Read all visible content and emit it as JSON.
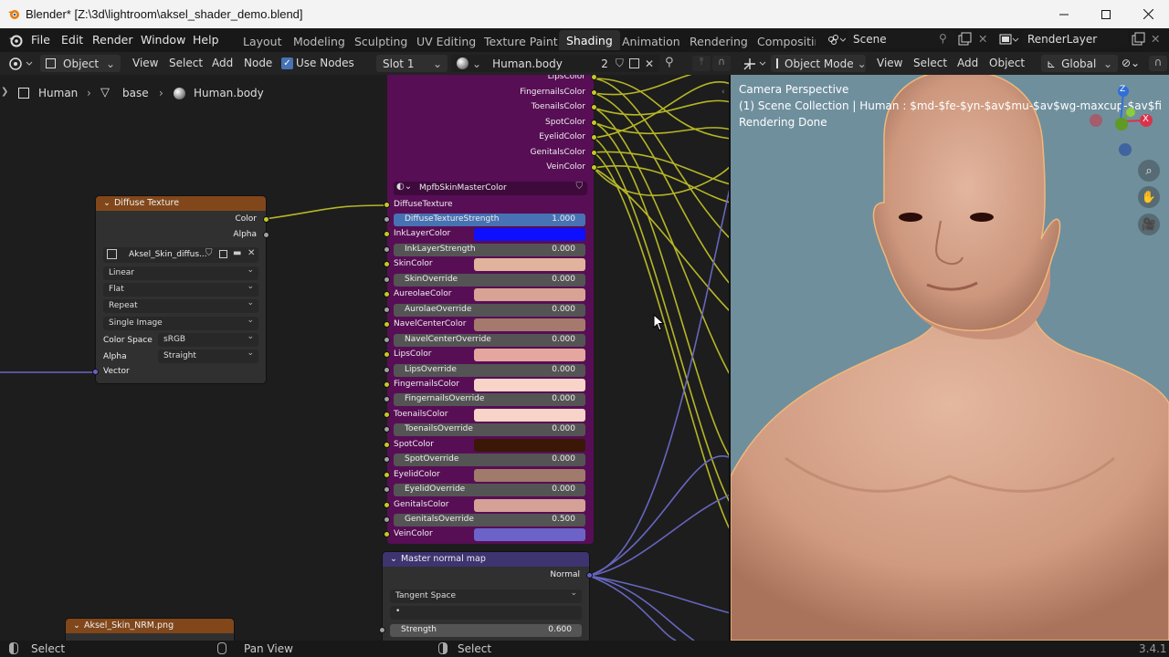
{
  "window": {
    "title": "Blender* [Z:\\3d\\lightroom\\aksel_shader_demo.blend]"
  },
  "menu": [
    "File",
    "Edit",
    "Render",
    "Window",
    "Help"
  ],
  "workspaces": [
    "Layout",
    "Modeling",
    "Sculpting",
    "UV Editing",
    "Texture Paint",
    "Shading",
    "Animation",
    "Rendering",
    "Compositing"
  ],
  "active_workspace": "Shading",
  "scene": "Scene",
  "view_layer": "RenderLayer",
  "node_header": {
    "object": "Object",
    "view": "View",
    "select": "Select",
    "add": "Add",
    "node": "Node",
    "use_nodes": "Use Nodes",
    "slot": "Slot 1",
    "material": "Human.body",
    "users": "2"
  },
  "breadcrumb": [
    "Human",
    "base",
    "Human.body"
  ],
  "viewport_header": {
    "mode": "Object Mode",
    "view": "View",
    "select": "Select",
    "add": "Add",
    "object": "Object",
    "orientation": "Global"
  },
  "diffuse_node": {
    "title": "Diffuse Texture",
    "outputs": [
      "Color",
      "Alpha"
    ],
    "image": "Aksel_Skin_diffus...",
    "interpolation": "Linear",
    "projection": "Flat",
    "extension": "Repeat",
    "source": "Single Image",
    "color_space_label": "Color Space",
    "color_space": "sRGB",
    "alpha_label": "Alpha",
    "alpha": "Straight",
    "vector": "Vector"
  },
  "group_node": {
    "top_outputs": [
      "LipsColor",
      "FingernailsColor",
      "ToenailsColor",
      "SpotColor",
      "EyelidColor",
      "GenitalsColor",
      "VeinColor"
    ],
    "group_name": "MpfbSkinMasterColor",
    "first_input": "DiffuseTexture",
    "inputs": [
      {
        "type": "val",
        "name": "DiffuseTextureStrength",
        "value": "1.000",
        "active": true
      },
      {
        "type": "color",
        "name": "InkLayerColor",
        "color": "#0f0fff"
      },
      {
        "type": "val",
        "name": "InkLayerStrength",
        "value": "0.000"
      },
      {
        "type": "color",
        "name": "SkinColor",
        "color": "#e2b39c"
      },
      {
        "type": "val",
        "name": "SkinOverride",
        "value": "0.000"
      },
      {
        "type": "color",
        "name": "AureolaeColor",
        "color": "#d8a394"
      },
      {
        "type": "val",
        "name": "AurolaeOverride",
        "value": "0.000"
      },
      {
        "type": "color",
        "name": "NavelCenterColor",
        "color": "#a57a6d"
      },
      {
        "type": "val",
        "name": "NavelCenterOverride",
        "value": "0.000"
      },
      {
        "type": "color",
        "name": "LipsColor",
        "color": "#e4a69e"
      },
      {
        "type": "val",
        "name": "LipsOverride",
        "value": "0.000"
      },
      {
        "type": "color",
        "name": "FingernailsColor",
        "color": "#f7d3c8"
      },
      {
        "type": "val",
        "name": "FingernailsOverride",
        "value": "0.000"
      },
      {
        "type": "color",
        "name": "ToenailsColor",
        "color": "#f7d3c8"
      },
      {
        "type": "val",
        "name": "ToenailsOverride",
        "value": "0.000"
      },
      {
        "type": "color",
        "name": "SpotColor",
        "color": "#3b1708"
      },
      {
        "type": "val",
        "name": "SpotOverride",
        "value": "0.000"
      },
      {
        "type": "color",
        "name": "EyelidColor",
        "color": "#a07a6b"
      },
      {
        "type": "val",
        "name": "EyelidOverride",
        "value": "0.000"
      },
      {
        "type": "color",
        "name": "GenitalsColor",
        "color": "#d5a197"
      },
      {
        "type": "val",
        "name": "GenitalsOverride",
        "value": "0.500"
      },
      {
        "type": "color",
        "name": "VeinColor",
        "color": "#6b63c8"
      }
    ]
  },
  "normal_node": {
    "title": "Master normal map",
    "output": "Normal",
    "space": "Tangent Space",
    "uv_map": "•",
    "strength_label": "Strength",
    "strength": "0.600"
  },
  "nrm_node": {
    "title": "Aksel_Skin_NRM.png"
  },
  "viewport": {
    "line1": "Camera Perspective",
    "line2": "(1) Scene Collection | Human : $md-$fe-$yn-$av$mu-$av$wg-maxcup-$av$fi",
    "line3": "Rendering Done"
  },
  "gizmo": {
    "z": "Z",
    "x": "X"
  },
  "status": {
    "left": "Select",
    "middle": "Pan View",
    "right": "Select",
    "version": "3.4.1"
  },
  "colors": {
    "group_body": "#570e55",
    "diffuse_hdr": "#81471b",
    "normal_hdr": "#3d3470",
    "active_slider": "#4772b3",
    "viewport_bg": "#6f8f9d"
  }
}
